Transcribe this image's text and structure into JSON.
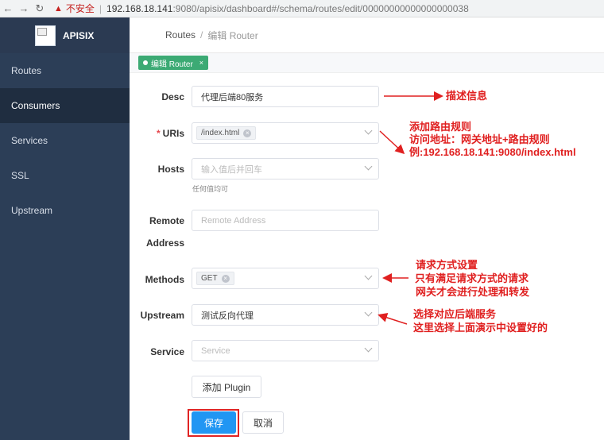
{
  "browser": {
    "back": "←",
    "forward": "→",
    "reload": "↻",
    "insecure_label": "不安全",
    "url_host": "192.168.18.141",
    "url_rest": ":9080/apisix/dashboard#/schema/routes/edit/00000000000000000038"
  },
  "sidebar": {
    "logo_text": "APISIX",
    "items": [
      {
        "label": "Routes"
      },
      {
        "label": "Consumers"
      },
      {
        "label": "Services"
      },
      {
        "label": "SSL"
      },
      {
        "label": "Upstream"
      }
    ]
  },
  "header": {
    "breadcrumb_root": "Routes",
    "breadcrumb_separator": "/",
    "breadcrumb_current": "编辑 Router"
  },
  "tabs": {
    "active_tag": "编辑 Router",
    "close": "×"
  },
  "form": {
    "desc": {
      "label": "Desc",
      "value": "代理后端80服务"
    },
    "uris": {
      "required": "*",
      "label": "URIs",
      "chip": "/index.html"
    },
    "hosts": {
      "label": "Hosts",
      "placeholder": "输入值后并回车",
      "hint": "任何值均可"
    },
    "remote_address": {
      "label_line1": "Remote",
      "label_line2": "Address",
      "placeholder": "Remote Address"
    },
    "methods": {
      "label": "Methods",
      "chip": "GET"
    },
    "upstream": {
      "label": "Upstream",
      "value": "测试反向代理"
    },
    "service": {
      "label": "Service",
      "placeholder": "Service"
    },
    "add_plugin": "添加 Plugin",
    "save": "保存",
    "cancel": "取消"
  },
  "annotations": {
    "desc_note": "描述信息",
    "uris_note": [
      "添加路由规则",
      "访问地址：网关地址+路由规则",
      "例:192.168.18.141:9080/index.html"
    ],
    "methods_note": [
      "请求方式设置",
      "只有满足请求方式的请求",
      "网关才会进行处理和转发"
    ],
    "upstream_note": [
      "选择对应后端服务",
      "这里选择上面演示中设置好的"
    ],
    "color": "#e02020"
  }
}
